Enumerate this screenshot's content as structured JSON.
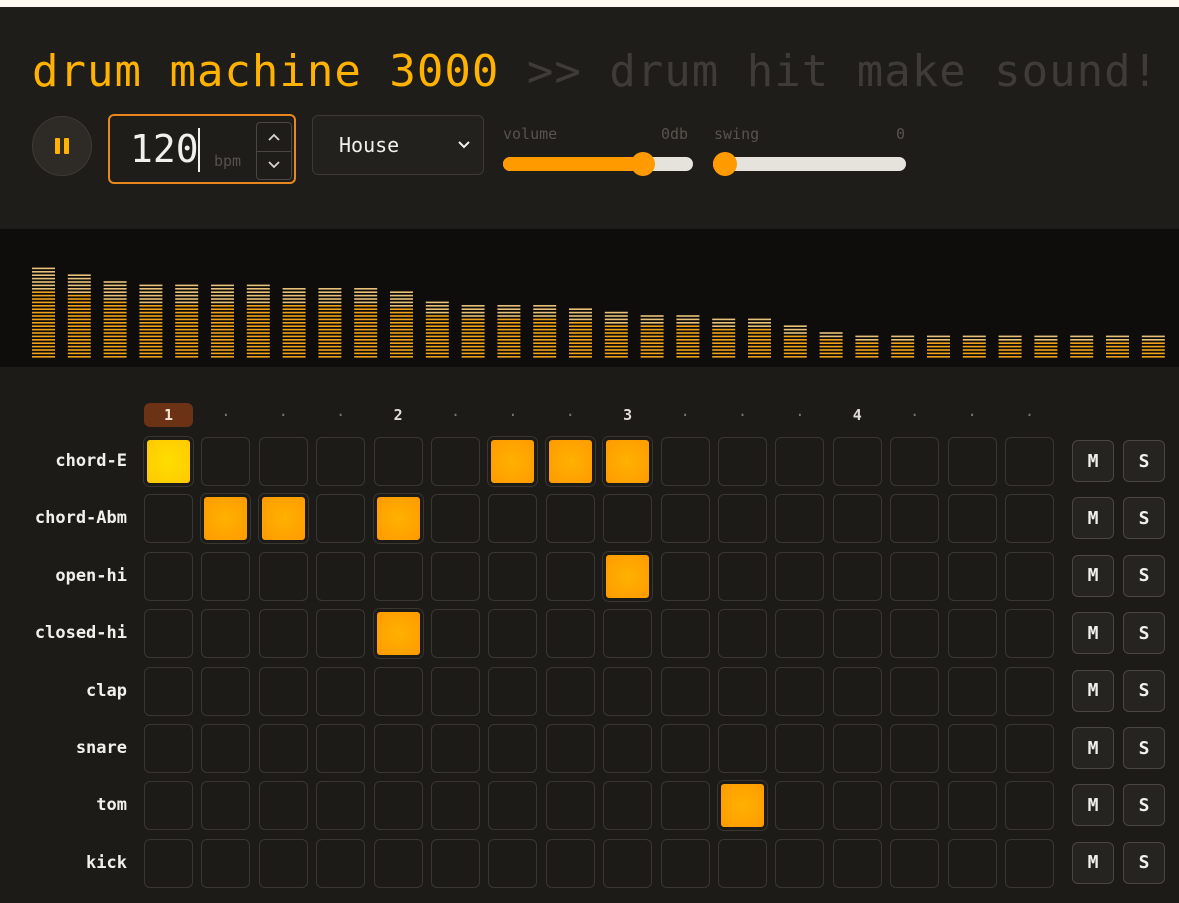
{
  "header": {
    "title": "drum machine 3000",
    "subtitle": ">> drum hit make sound!"
  },
  "transport": {
    "play_state": "playing",
    "pause_icon": "pause-icon",
    "bpm_value": "120",
    "bpm_unit": "bpm",
    "kit_selected": "House",
    "volume_label": "volume",
    "volume_value": "0db",
    "volume_level": 0.77,
    "swing_label": "swing",
    "swing_value": "0",
    "swing_level": 0.0
  },
  "visualizer": {
    "bar_levels": [
      0.82,
      0.78,
      0.72,
      0.68,
      0.68,
      0.68,
      0.68,
      0.64,
      0.64,
      0.64,
      0.62,
      0.54,
      0.5,
      0.5,
      0.5,
      0.46,
      0.44,
      0.4,
      0.4,
      0.36,
      0.36,
      0.32,
      0.26,
      0.22,
      0.22,
      0.22,
      0.22,
      0.22,
      0.22,
      0.22,
      0.22,
      0.22
    ]
  },
  "beats": [
    "1",
    "·",
    "·",
    "·",
    "2",
    "·",
    "·",
    "·",
    "3",
    "·",
    "·",
    "·",
    "4",
    "·",
    "·",
    "·"
  ],
  "current_step": 0,
  "tracks": [
    {
      "name": "chord-E",
      "steps": [
        1,
        0,
        0,
        0,
        0,
        0,
        1,
        1,
        1,
        0,
        0,
        0,
        0,
        0,
        0,
        0
      ]
    },
    {
      "name": "chord-Abm",
      "steps": [
        0,
        1,
        1,
        0,
        1,
        0,
        0,
        0,
        0,
        0,
        0,
        0,
        0,
        0,
        0,
        0
      ]
    },
    {
      "name": "open-hi",
      "steps": [
        0,
        0,
        0,
        0,
        0,
        0,
        0,
        0,
        1,
        0,
        0,
        0,
        0,
        0,
        0,
        0
      ]
    },
    {
      "name": "closed-hi",
      "steps": [
        0,
        0,
        0,
        0,
        1,
        0,
        0,
        0,
        0,
        0,
        0,
        0,
        0,
        0,
        0,
        0
      ]
    },
    {
      "name": "clap",
      "steps": [
        0,
        0,
        0,
        0,
        0,
        0,
        0,
        0,
        0,
        0,
        0,
        0,
        0,
        0,
        0,
        0
      ]
    },
    {
      "name": "snare",
      "steps": [
        0,
        0,
        0,
        0,
        0,
        0,
        0,
        0,
        0,
        0,
        0,
        0,
        0,
        0,
        0,
        0
      ]
    },
    {
      "name": "tom",
      "steps": [
        0,
        0,
        0,
        0,
        0,
        0,
        0,
        0,
        0,
        0,
        1,
        0,
        0,
        0,
        0,
        0
      ]
    },
    {
      "name": "kick",
      "steps": [
        0,
        0,
        0,
        0,
        0,
        0,
        0,
        0,
        0,
        0,
        0,
        0,
        0,
        0,
        0,
        0
      ]
    }
  ],
  "mute_label": "M",
  "solo_label": "S",
  "colors": {
    "accent": "#ffb300",
    "step_on": "#ff9a00",
    "step_playhead": "#ffd000",
    "beat_active_bg": "#6b3215"
  }
}
